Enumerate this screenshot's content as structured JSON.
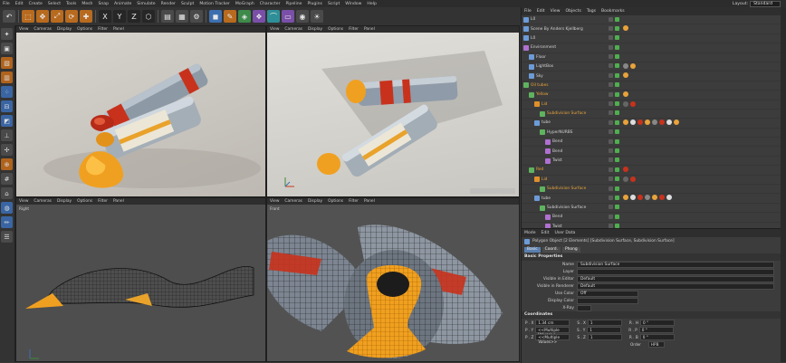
{
  "menu": [
    "File",
    "Edit",
    "Create",
    "Select",
    "Tools",
    "Mesh",
    "Snap",
    "Animate",
    "Simulate",
    "Render",
    "Sculpt",
    "Motion Tracker",
    "MoGraph",
    "Character",
    "Pipeline",
    "Plugins",
    "Script",
    "Window",
    "Help"
  ],
  "layout": {
    "label": "Layout:",
    "value": "Standard"
  },
  "viewport_menu": [
    "View",
    "Cameras",
    "Display",
    "Options",
    "Filter",
    "Panel"
  ],
  "viewports": {
    "right_label": "Right",
    "front_label": "Front"
  },
  "object_manager": {
    "menu": [
      "File",
      "Edit",
      "View",
      "Objects",
      "Tags",
      "Bookmarks"
    ],
    "rows": [
      {
        "name": "L0",
        "hi": false
      },
      {
        "name": "Scene By Anders Kjellberg",
        "hi": false
      },
      {
        "name": "L0",
        "hi": false
      },
      {
        "name": "Environment",
        "hi": false
      },
      {
        "name": "Floor",
        "hi": false
      },
      {
        "name": "LightBox",
        "hi": false
      },
      {
        "name": "Sky",
        "hi": false
      },
      {
        "name": "Oil tubes",
        "hi": true
      },
      {
        "name": "Yellow",
        "hi": true
      },
      {
        "name": "Lid",
        "hi": true
      },
      {
        "name": "Subdivision Surface",
        "hi": true
      },
      {
        "name": "tube",
        "hi": false
      },
      {
        "name": "HyperNURBS",
        "hi": false
      },
      {
        "name": "Bend",
        "hi": false
      },
      {
        "name": "Bend",
        "hi": false
      },
      {
        "name": "Twist",
        "hi": false
      },
      {
        "name": "Red",
        "hi": true
      },
      {
        "name": "Lid",
        "hi": true
      },
      {
        "name": "Subdivision Surface",
        "hi": true
      },
      {
        "name": "tube",
        "hi": false
      },
      {
        "name": "Subdivision Surface",
        "hi": false
      },
      {
        "name": "Bend",
        "hi": false
      },
      {
        "name": "Twist",
        "hi": false
      }
    ]
  },
  "attribute_manager": {
    "menu": [
      "Mode",
      "Edit",
      "User Data"
    ],
    "title": "Polygon Object [2 Elements] [Subdivision Surface, Subdivision Surface]",
    "tabs": [
      "Basic",
      "Coord.",
      "Phong"
    ],
    "section_basic": "Basic Properties",
    "fields": [
      {
        "label": "Name",
        "value": "Subdivision Surface"
      },
      {
        "label": "Layer",
        "value": ""
      },
      {
        "label": "Visible in Editor",
        "value": "Default"
      },
      {
        "label": "Visible in Renderer",
        "value": "Default"
      },
      {
        "label": "Use Color",
        "value": "Off"
      },
      {
        "label": "Display Color",
        "value": ""
      },
      {
        "label": "X-Ray",
        "value": ""
      }
    ],
    "section_coords": "Coordinates",
    "coords": [
      {
        "p": "P . X",
        "pv": "1.34 cm",
        "s": "S . X",
        "sv": "1",
        "r": "R . H",
        "rv": "0 °"
      },
      {
        "p": "P . Y",
        "pv": "<<Multiple Values>>",
        "s": "S . Y",
        "sv": "1",
        "r": "R . P",
        "rv": "0 °"
      },
      {
        "p": "P . Z",
        "pv": "<<Multiple Values>>",
        "s": "S . Z",
        "sv": "1",
        "r": "R . B",
        "rv": "0 °"
      }
    ],
    "order_label": "Order",
    "order_value": "HPB"
  },
  "colors": {
    "accent": "#e8a33a",
    "background": "#3a3a3a",
    "yellow_paint": "#f0a020",
    "red_paint": "#c83a1e"
  }
}
